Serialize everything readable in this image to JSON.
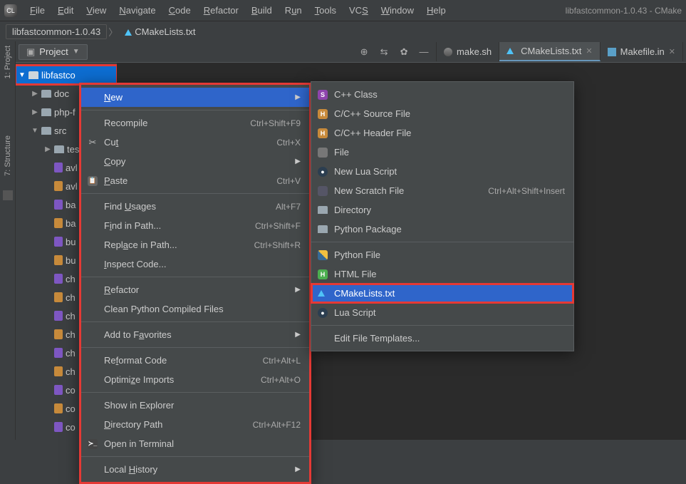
{
  "titlebar": {
    "menus": [
      "File",
      "Edit",
      "View",
      "Navigate",
      "Code",
      "Refactor",
      "Build",
      "Run",
      "Tools",
      "VCS",
      "Window",
      "Help"
    ],
    "title_right": "libfastcommon-1.0.43 - CMake"
  },
  "breadcrumb": {
    "seg1": "libfastcommon-1.0.43",
    "seg2": "CMakeLists.txt"
  },
  "proj_header": {
    "label": "Project"
  },
  "tabs": [
    {
      "label": "make.sh",
      "icon": "gear",
      "active": false
    },
    {
      "label": "CMakeLists.txt",
      "icon": "cmake",
      "active": true
    },
    {
      "label": "Makefile.in",
      "icon": "makefile",
      "active": false
    }
  ],
  "tree": {
    "root": "libfastco",
    "items": [
      {
        "kind": "folder",
        "name": "doc",
        "indent": 1,
        "chev": "▶"
      },
      {
        "kind": "folder",
        "name": "php-f",
        "indent": 1,
        "chev": "▶"
      },
      {
        "kind": "folder",
        "name": "src",
        "indent": 1,
        "chev": "▼"
      },
      {
        "kind": "folder",
        "name": "tes",
        "indent": 2,
        "chev": "▶"
      },
      {
        "kind": "c",
        "name": "avl",
        "indent": 2
      },
      {
        "kind": "h",
        "name": "avl",
        "indent": 2
      },
      {
        "kind": "c",
        "name": "ba",
        "indent": 2
      },
      {
        "kind": "h",
        "name": "ba",
        "indent": 2
      },
      {
        "kind": "c",
        "name": "bu",
        "indent": 2
      },
      {
        "kind": "h",
        "name": "bu",
        "indent": 2
      },
      {
        "kind": "c",
        "name": "ch",
        "indent": 2
      },
      {
        "kind": "h",
        "name": "ch",
        "indent": 2
      },
      {
        "kind": "c",
        "name": "ch",
        "indent": 2
      },
      {
        "kind": "h",
        "name": "ch",
        "indent": 2
      },
      {
        "kind": "c",
        "name": "ch",
        "indent": 2
      },
      {
        "kind": "h",
        "name": "ch",
        "indent": 2
      },
      {
        "kind": "c",
        "name": "co",
        "indent": 2
      },
      {
        "kind": "h",
        "name": "co",
        "indent": 2
      },
      {
        "kind": "c",
        "name": "co",
        "indent": 2
      }
    ]
  },
  "ctx_main": [
    {
      "type": "item",
      "label": "New",
      "shortcut": "",
      "icon": "",
      "hover": true,
      "submenu": true
    },
    {
      "type": "sep"
    },
    {
      "type": "item",
      "label": "Recompile",
      "shortcut": "Ctrl+Shift+F9",
      "icon": ""
    },
    {
      "type": "item",
      "label": "Cut",
      "shortcut": "Ctrl+X",
      "icon": "cut"
    },
    {
      "type": "item",
      "label": "Copy",
      "shortcut": "",
      "icon": "",
      "submenu": true
    },
    {
      "type": "item",
      "label": "Paste",
      "shortcut": "Ctrl+V",
      "icon": "paste"
    },
    {
      "type": "sep"
    },
    {
      "type": "item",
      "label": "Find Usages",
      "shortcut": "Alt+F7",
      "icon": ""
    },
    {
      "type": "item",
      "label": "Find in Path...",
      "shortcut": "Ctrl+Shift+F",
      "icon": ""
    },
    {
      "type": "item",
      "label": "Replace in Path...",
      "shortcut": "Ctrl+Shift+R",
      "icon": ""
    },
    {
      "type": "item",
      "label": "Inspect Code...",
      "shortcut": "",
      "icon": ""
    },
    {
      "type": "sep"
    },
    {
      "type": "item",
      "label": "Refactor",
      "shortcut": "",
      "icon": "",
      "submenu": true
    },
    {
      "type": "item",
      "label": "Clean Python Compiled Files",
      "shortcut": "",
      "icon": ""
    },
    {
      "type": "sep"
    },
    {
      "type": "item",
      "label": "Add to Favorites",
      "shortcut": "",
      "icon": "",
      "submenu": true
    },
    {
      "type": "sep"
    },
    {
      "type": "item",
      "label": "Reformat Code",
      "shortcut": "Ctrl+Alt+L",
      "icon": ""
    },
    {
      "type": "item",
      "label": "Optimize Imports",
      "shortcut": "Ctrl+Alt+O",
      "icon": ""
    },
    {
      "type": "sep"
    },
    {
      "type": "item",
      "label": "Show in Explorer",
      "shortcut": "",
      "icon": ""
    },
    {
      "type": "item",
      "label": "Directory Path",
      "shortcut": "Ctrl+Alt+F12",
      "icon": ""
    },
    {
      "type": "item",
      "label": "Open in Terminal",
      "shortcut": "",
      "icon": "terminal"
    },
    {
      "type": "sep"
    },
    {
      "type": "item",
      "label": "Local History",
      "shortcut": "",
      "icon": "",
      "submenu": true
    }
  ],
  "ctx_sub": [
    {
      "label": "C++ Class",
      "icon": "s-purple",
      "shortcut": ""
    },
    {
      "label": "C/C++ Source File",
      "icon": "h-orange",
      "shortcut": ""
    },
    {
      "label": "C/C++ Header File",
      "icon": "h-orange",
      "shortcut": ""
    },
    {
      "label": "File",
      "icon": "file",
      "shortcut": ""
    },
    {
      "label": "New Lua Script",
      "icon": "lua",
      "shortcut": ""
    },
    {
      "label": "New Scratch File",
      "icon": "scratch",
      "shortcut": "Ctrl+Alt+Shift+Insert"
    },
    {
      "label": "Directory",
      "icon": "folder",
      "shortcut": ""
    },
    {
      "label": "Python Package",
      "icon": "folder",
      "shortcut": ""
    },
    {
      "sep": true
    },
    {
      "label": "Python File",
      "icon": "python",
      "shortcut": ""
    },
    {
      "label": "HTML File",
      "icon": "html",
      "shortcut": ""
    },
    {
      "label": "CMakeLists.txt",
      "icon": "cmake",
      "shortcut": "",
      "hover": true,
      "highlight": true
    },
    {
      "label": "Lua Script",
      "icon": "lua",
      "shortcut": ""
    },
    {
      "sep": true
    },
    {
      "label": "Edit File Templates...",
      "icon": "",
      "shortcut": ""
    }
  ],
  "rails": {
    "project": "1: Project",
    "structure": "7: Structure"
  }
}
